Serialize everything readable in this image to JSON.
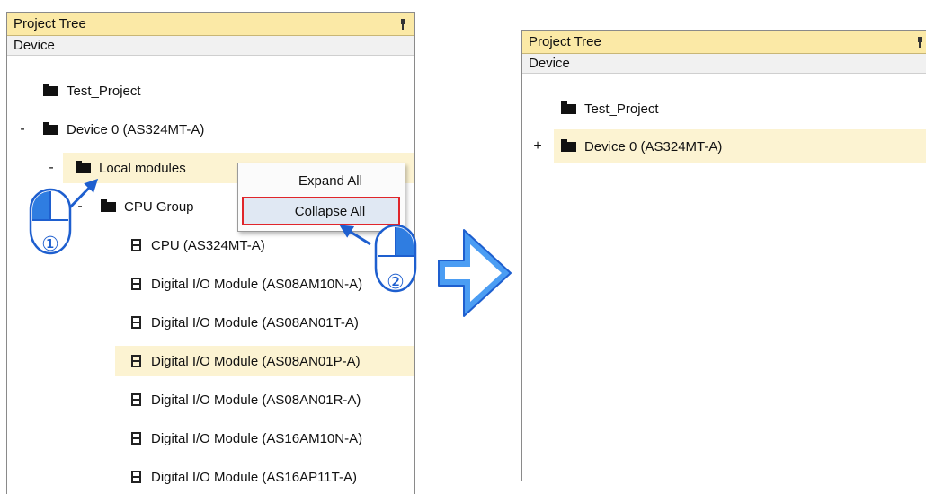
{
  "left_panel": {
    "title": "Project Tree",
    "subheader": "Device",
    "rows": [
      {
        "label": "Test_Project",
        "toggle": ""
      },
      {
        "label": "Device 0 (AS324MT-A)",
        "toggle": "-"
      },
      {
        "label": "Local modules",
        "toggle": "-"
      },
      {
        "label": "CPU Group",
        "toggle": "-"
      },
      {
        "label": "CPU (AS324MT-A)",
        "toggle": ""
      },
      {
        "label": "Digital I/O Module (AS08AM10N-A)",
        "toggle": ""
      },
      {
        "label": "Digital I/O Module (AS08AN01T-A)",
        "toggle": ""
      },
      {
        "label": "Digital I/O Module (AS08AN01P-A)",
        "toggle": ""
      },
      {
        "label": "Digital I/O Module (AS08AN01R-A)",
        "toggle": ""
      },
      {
        "label": "Digital I/O Module (AS16AM10N-A)",
        "toggle": ""
      },
      {
        "label": "Digital I/O Module (AS16AP11T-A)",
        "toggle": ""
      }
    ]
  },
  "context_menu": {
    "items": [
      {
        "label": "Expand All"
      },
      {
        "label": "Collapse All"
      }
    ]
  },
  "right_panel": {
    "title": "Project Tree",
    "subheader": "Device",
    "rows": [
      {
        "label": "Test_Project",
        "toggle": ""
      },
      {
        "label": "Device 0 (AS324MT-A)",
        "toggle": "+"
      }
    ]
  },
  "annotations": {
    "step1": "①",
    "step2": "②"
  },
  "colors": {
    "title_bar": "#fbe9a6",
    "row_highlight": "#fcf3d2",
    "callout_blue": "#1e5fcf",
    "menu_highlight_border": "#e0252a"
  }
}
